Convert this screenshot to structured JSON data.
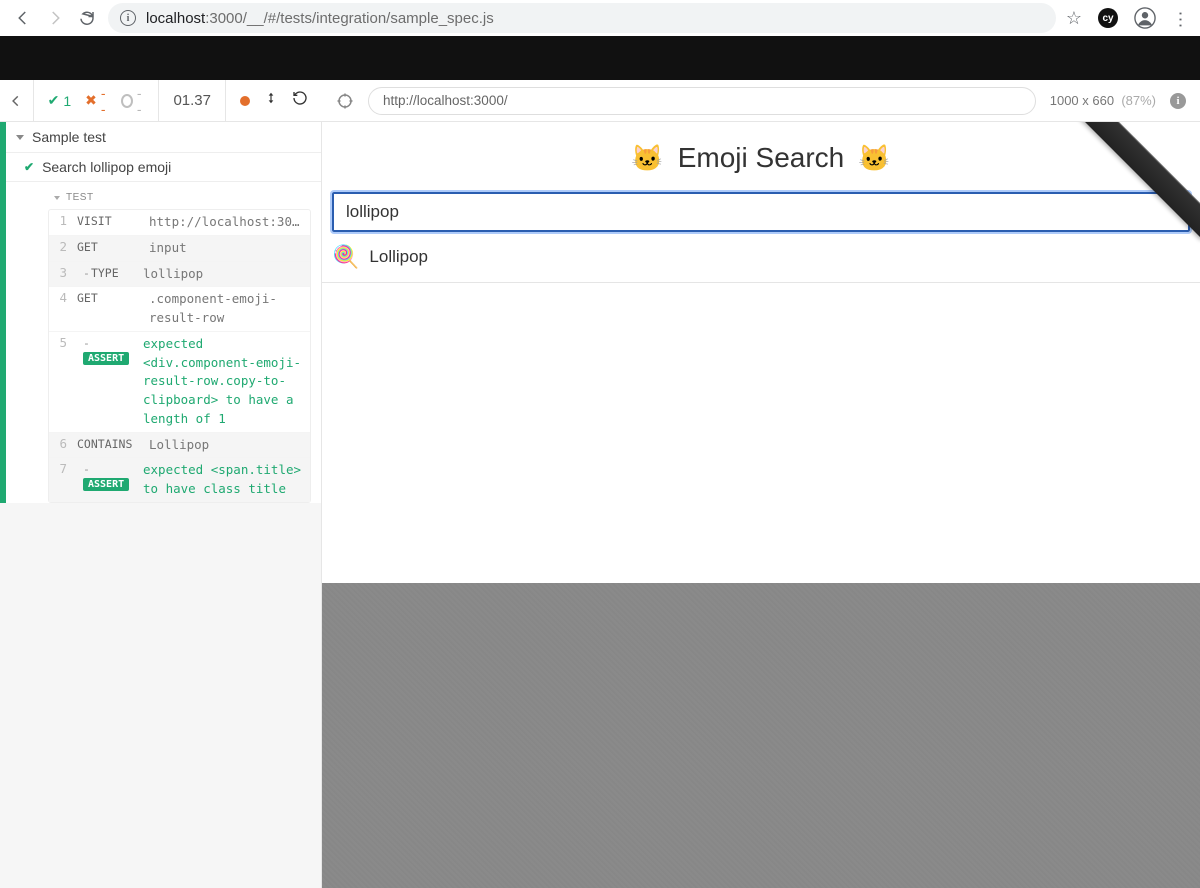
{
  "browser": {
    "url_host": "localhost",
    "url_port": ":3000/",
    "url_path": "__/#/tests/integration/sample_spec.js"
  },
  "cypress": {
    "pass_count": "1",
    "fail_count": "--",
    "pending_count": "--",
    "duration": "01.37",
    "app_url": "http://localhost:3000/",
    "viewport": "1000 x 660",
    "zoom": "(87%)"
  },
  "suite": {
    "name": "Sample test",
    "test_name": "Search lollipop emoji",
    "body_label": "TEST"
  },
  "commands": [
    {
      "n": "1",
      "method": "VISIT",
      "sub": false,
      "assert": false,
      "args": "http://localhost:30…",
      "green": false,
      "gray": false
    },
    {
      "n": "2",
      "method": "GET",
      "sub": false,
      "assert": false,
      "args": "input",
      "green": false,
      "gray": true
    },
    {
      "n": "3",
      "method": "TYPE",
      "sub": true,
      "assert": false,
      "args": "lollipop",
      "green": false,
      "gray": true
    },
    {
      "n": "4",
      "method": "GET",
      "sub": false,
      "assert": false,
      "args": ".component-emoji-result-row",
      "green": false,
      "gray": false
    },
    {
      "n": "5",
      "method": "ASSERT",
      "sub": true,
      "assert": true,
      "args": "expected <div.component-emoji-result-row.copy-to-clipboard> to have a length of 1",
      "green": true,
      "gray": false
    },
    {
      "n": "6",
      "method": "CONTAINS",
      "sub": false,
      "assert": false,
      "args": "Lollipop",
      "green": false,
      "gray": true
    },
    {
      "n": "7",
      "method": "ASSERT",
      "sub": true,
      "assert": true,
      "args": "expected <span.title> to have class title",
      "green": true,
      "gray": true
    }
  ],
  "app": {
    "title": "Emoji Search",
    "search_value": "lollipop",
    "result_title": "Lollipop",
    "result_emoji": "🍭",
    "header_emoji": "🐱"
  }
}
